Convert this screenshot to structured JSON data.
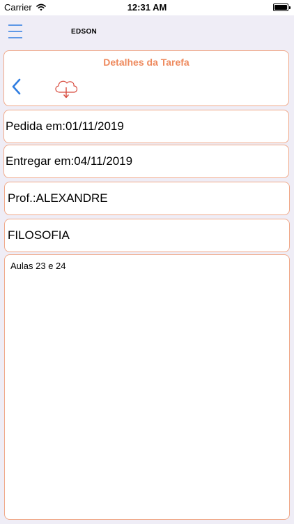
{
  "status_bar": {
    "carrier": "Carrier",
    "time": "12:31 AM"
  },
  "nav": {
    "title": "EDSON",
    "menu_icon": "hamburger-menu-icon"
  },
  "task": {
    "header_title": "Detalhes da Tarefa",
    "back_icon": "chevron-left-icon",
    "download_icon": "cloud-download-icon",
    "requested_on": "Pedida em:01/11/2019",
    "due_on": "Entregar em:04/11/2019",
    "teacher": "Prof.:ALEXANDRE",
    "subject": "FILOSOFIA",
    "notes": "Aulas 23 e 24"
  },
  "colors": {
    "accent": "#ee8a5e",
    "card_border": "#f0a98a",
    "ios_blue": "#2f7de1",
    "download_red": "#d84b3e"
  }
}
